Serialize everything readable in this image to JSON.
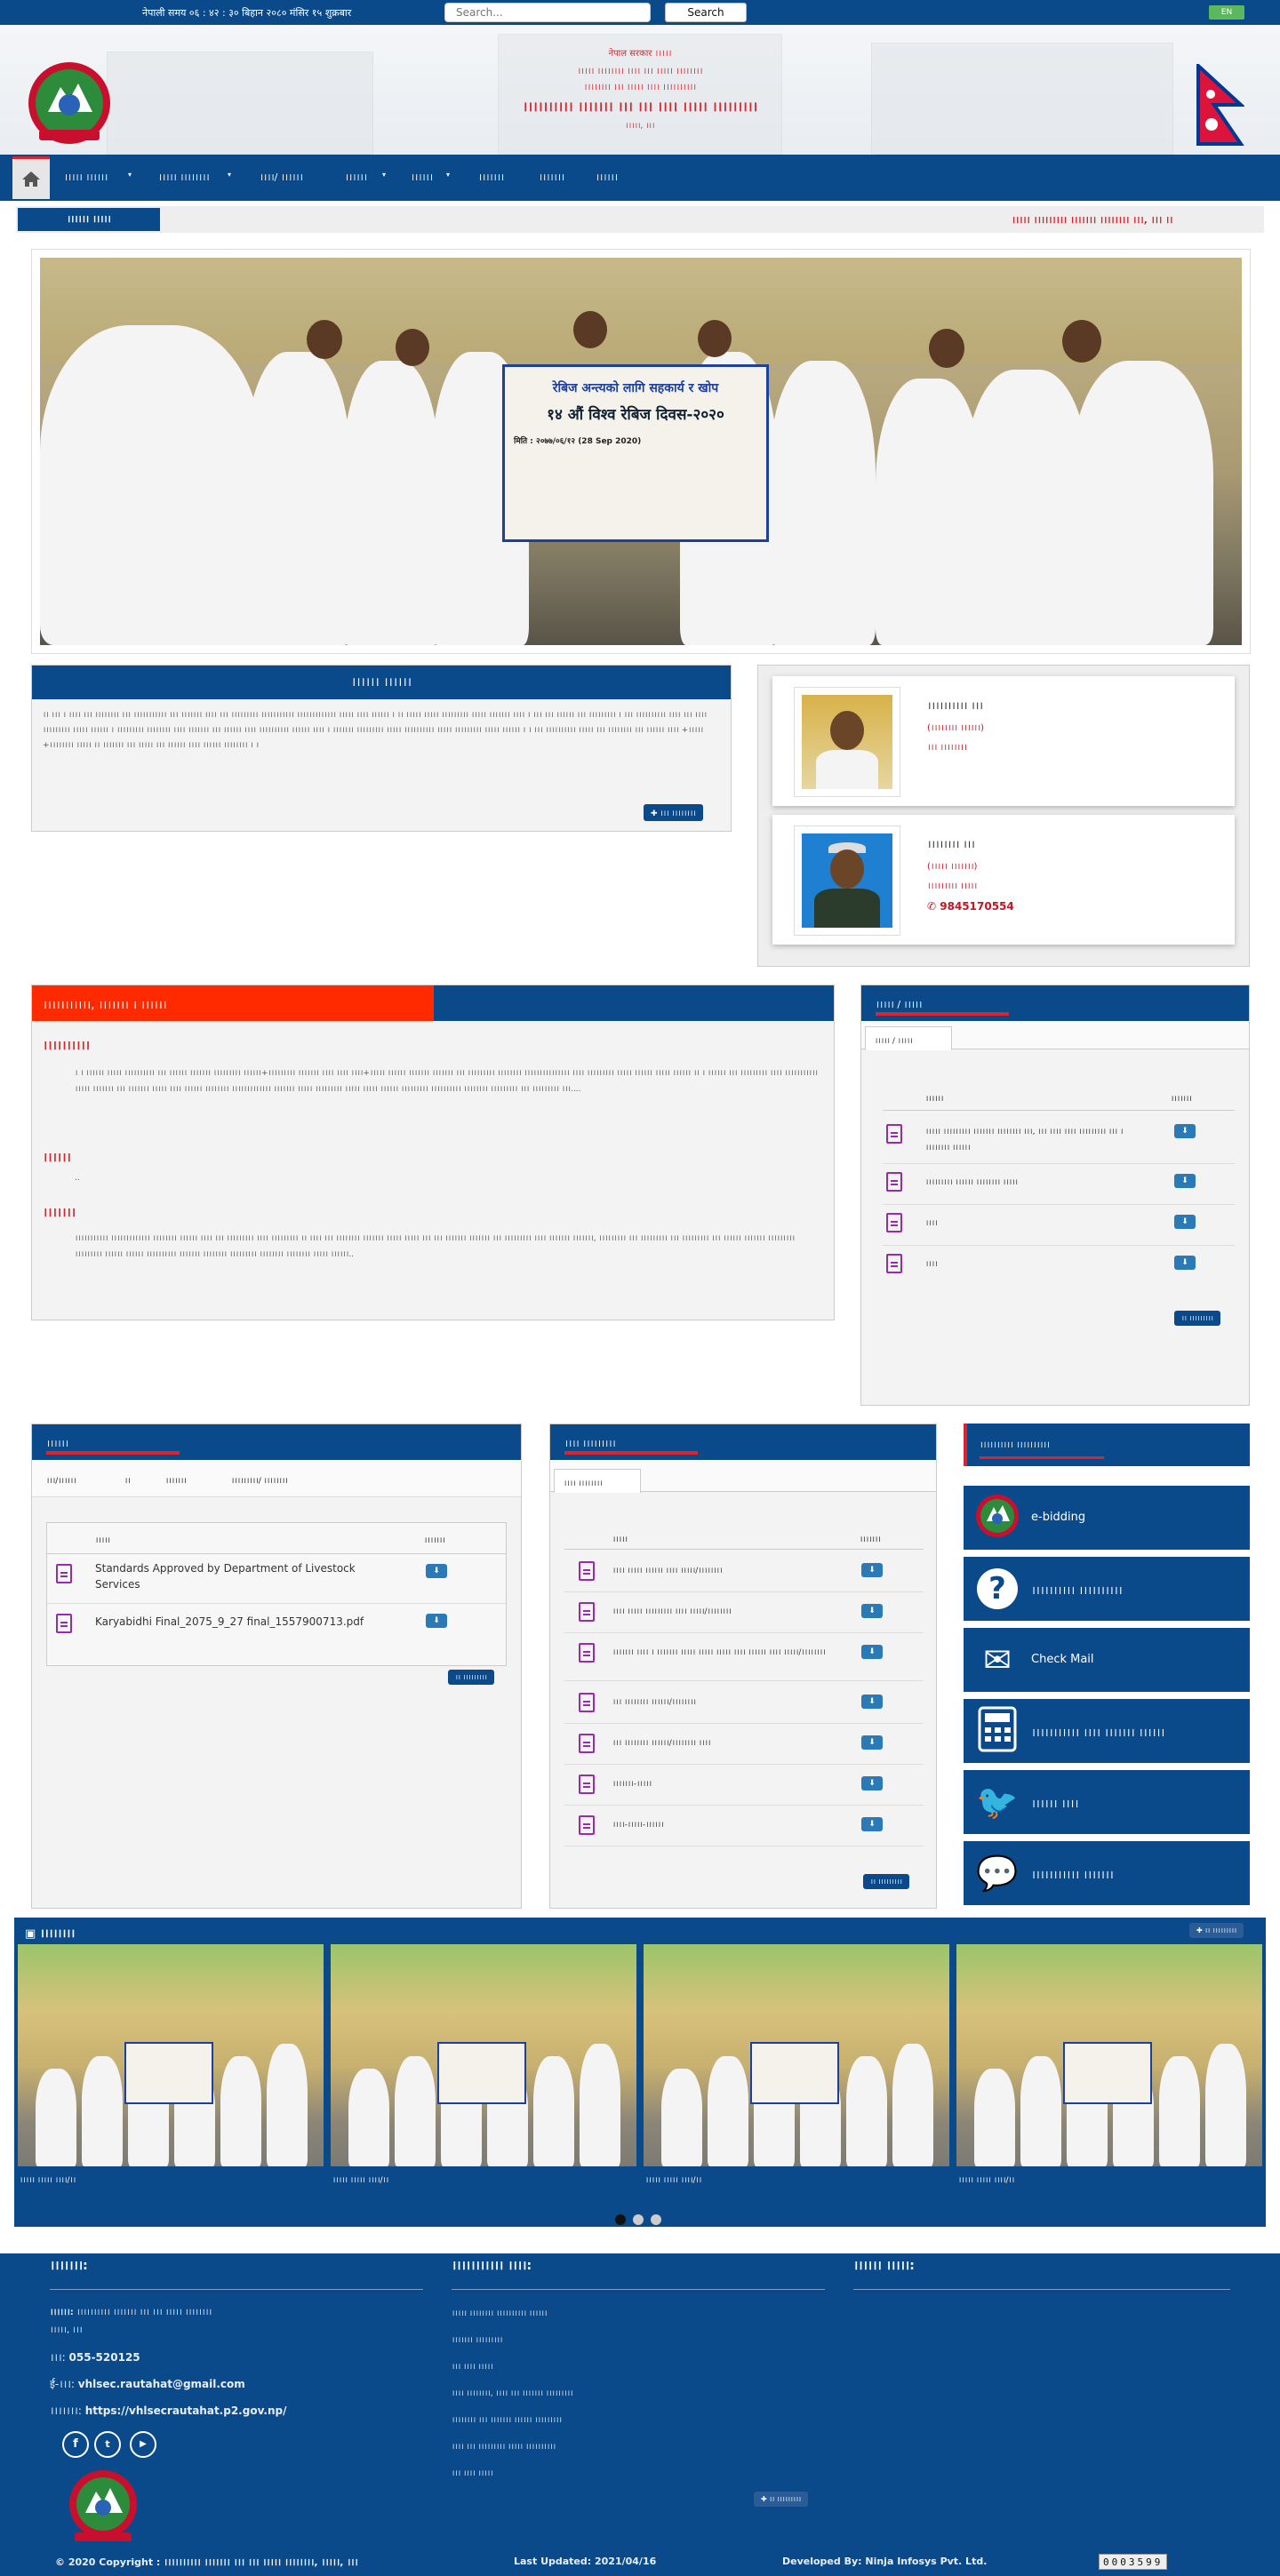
{
  "topbar": {
    "time": "नेपाली समय ०६ : ४२ : ३० बिहान   २०८० मंसिर १५ शुक्रबार",
    "search_placeholder": "Search...",
    "search_label": "Search",
    "lang_label": "EN"
  },
  "header": {
    "line1": "नेपाल सरकार ।।।।।",
    "line2": "।।।।। ।।।।।।।। ।।।। ।।। ।।।।। ।।।।।।।।",
    "line3": "।।।।।।।। ।।। ।।।।। ।।।। ।।।।।।।।।।",
    "title": "।।।।।।।।।। ।।।।।।। ।।। ।।। ।।।। ।।।।। ।।।।।।।।।",
    "location": "।।।।।, ।।।"
  },
  "nav": {
    "items": [
      "।।।।। ।।।।।।",
      "।।।।। ।।।।।।।।",
      "।।।।/ ।।।।।।",
      "।।।।।।",
      "।।।।।।",
      "।।।।।।।",
      "।।।।।।।",
      "।।।।।।"
    ]
  },
  "ticker": {
    "label": "।।।।।। ।।।।।",
    "text": "।।।।। ।।।।।।।।। ।।।।।।। ।।।।।।।। ।।।, ।।। ।।"
  },
  "slide": {
    "banner_line1": "रेबिज अन्त्यको लागि सहकार्य र खोप",
    "banner_line2": "१४ औं विश्व रेबिज दिवस-२०२०",
    "banner_line3": "मिति : २०७७/०६/१२ (28 Sep 2020)"
  },
  "about": {
    "title": "।।।।।। ।।।।।।",
    "text": "।। ।।। । ।।।। ।।। ।।।।।।।। ।।। ।।।।।।।।।।। ।।। ।।।।।।। ।।।। ।।। ।।।।।।।।। ।।।।।।।।।।। ।।।।।।।।।।।।। ।।।।। ।।।। ।।।।।। । ।। ।।।।। ।।।।। ।।।।।।।।। ।।।।। ।।।।।।। ।।।। । ।।। ।।। ।।।।।। ।।। ।।।।।।।।। । ।।। ।।।।।।।।।। ।।।। ।।। ।।।। ।।।।।।।।। ।।।।। ।।।।।। । ।।।।।।।।। ।।।।।।।। ।।।। ।।।।।।। ।।। ।।।।।। ।।।। ।।।।।।।।।। ।।।।।। ।।।। । ।।।।।।। ।।।।।।।।। ।।।।। ।।।।।।।।।। ।।।।। ।।।।।।।।। ।।।।। ।।।।।। । । ।।। ।।।।।।।।।। ।।।।। ।।। ।।।।।।।। ।।। ।।।।।। ।।।। +।।।।। +।।।।।।।। ।।।।। ।। ।।।।।।। ।।। ।।।।। ।।। ।।।।।। ।।।। ।।।।।। ।।।।।।।। । ।",
    "more_label": "।।। ।।।।।।।।"
  },
  "officials": [
    {
      "name": "।।।।।।।।।। ।।।",
      "role": "(।।।।।।।। ।।।।।।)",
      "dept": "।।। ।।।।।।।।",
      "phone": ""
    },
    {
      "name": "।।।।।।।। ।।।",
      "role": "(।।।।। ।।।।।।।)",
      "dept": "।।।।।।।।। ।।।।।",
      "phone": "9845170554"
    }
  ],
  "mission": {
    "tabs": [
      "।।।।।।।।।।।, ।।।।।।। । ।।।।।।",
      ""
    ],
    "h1": "।।।।।।।।।।",
    "p1": "। ।      ।।।।।। ।।।।। ।।।।।।।।।। ।।। ।।।।।। ।।।।।।। ।।।।।।।।। ।।।।।।+।।।।।।।।। ।।।।।।। ।।।। ।।।। ।।।।+।।।।। ।।।।।। ।।।।।।। ।।।।।।। ।।। ।।।।।।।।। ।।।।।।।। ।।।।।।।।।।।।।।। ।।।। ।।।।।।।।। ।।।।। ।।।।।। ।।।।। ।।।।।। ।। ।      ।।।।।। ।।। ।।।।।।।।। ।।।। ।।।।।।।।।।। ।।।।। ।।।।।।। ।।। ।।।।।।। ।।।।। ।।।। ।।।।।। ।।।।।।।। ।।।।।।।।।।।।। ।।।।।।। ।।।।। ।।।।।।।।। ।।।।। ।।।।। ।।।।।। ।।।।।।।।। ।।।।।।।।।। ।।।।।।।। ।।।।।।।।। ।।। ।।।।।।।।। ।।।....",
    "h2": "।।।।।।",
    "p2": "..",
    "h3": "।।।।।।।",
    "p3": "।।।।।।।।।।। ।।।।।।।।।।।।। ।।।।।।।। ।।।।।। ।।।। ।।। ।।।।।।।।। ।।।। ।।।।।।।।। ।। ।।।। ।।। ।।।।।।।। ।।।।।।। ।।।।। ।।।।। ।।। ।।। ।।।।।।। ।।।।।।। ।।। ।।।।।।।।। ।।।। ।।।।।।। ।।।।।।।, ।।।।।।।।। ।।। ।।।।।।।।। ।।। ।।।।।।।।।  ।।। ।।।।।। ।।।।।।। ।।।।।।।।। ।।।।।।।।। ।।।।।। ।।।।।। ।।।।।।।।।। ।।।।।।। ।।।।।।।। ।।।।।।।।। ।।।।।।।। ।।।।।।।। ।।।।। ।।।।।।.."
  },
  "circular": {
    "title": "।।।।। / ।।।।।",
    "tab": "।।।।। / ।।।।।",
    "col_name": "।।।।।।",
    "col_dl": "।।।।।।।",
    "rows": [
      "।।।।। ।।।।।।।।। ।।।।।।। ।।।।।।।। ।।।, ।।। ।।।। ।।।। ।।।।।।।।। ।।। । ।।।।।।।। ।।।।।।",
      "।।।।।।।।। ।।।।।। ।।।।।।।। ।।।।।",
      "।।।।",
      "।।।।"
    ],
    "more_label": "।। ।।।।।।।।।"
  },
  "laws": {
    "title": "।।।।।।",
    "tabs": [
      "।।।/।।।।।।",
      "।।",
      "।।।।।।।",
      "।।।।।।।।।/ ।।।।।।।।"
    ],
    "col_name": "।।।।।",
    "col_dl": "।।।।।।।",
    "rows": [
      "Standards Approved by Department of Livestock Services",
      "Karyabidhi Final_2075_9_27 final_1557900713.pdf"
    ],
    "more_label": "।। ।।।।।।।।।"
  },
  "publications": {
    "title": "।।।। ।।।।।।।।।",
    "tab": "।।।। ।।।।।।।।",
    "col_name": "।।।।।",
    "col_dl": "।।।।।।।",
    "rows": [
      "।।।। ।।।।। ।।।।।। ।।।। ।।।।।/।।।।।।।।",
      "।।।। ।।।।। ।।।।।।।।। ।।।। ।।।।।/।।।।।।।।",
      "।।।।।।। ।।।। । ।।।।।।। ।।।।। ।।।।। ।।।।। ।।।। ।।।।।। ।।।। ।।।।।/।।।।।।।।",
      "।।। ।।।।।।।। ।।।।।।/।।।।।।।।",
      "।।। ।।।।।।।। ।।।।।।/।।।।।।।। ।।।।",
      "।।।।।।।-।।।।।",
      "।।।।-।।।।।-।।।।।।"
    ],
    "more_label": "।। ।।।।।।।।।"
  },
  "links": {
    "title": "।।।।।।।।।। ।।।।।।।।।।",
    "items": [
      {
        "label": "e-bidding",
        "icon": "nepal-emblem-icon"
      },
      {
        "label": "।।।।।।।।।। ।।।।।।।।।।",
        "icon": "question-icon"
      },
      {
        "label": "Check Mail",
        "icon": "mail-icon"
      },
      {
        "label": "।।।।।।।।।।। ।।।। ।।।।।।। ।।।।।।",
        "icon": "calculator-icon"
      },
      {
        "label": "।।।।।। ।।।।",
        "icon": "twitter-icon"
      },
      {
        "label": "।।।।।।।।।।। ।।।।।।।",
        "icon": "chat-icon"
      }
    ]
  },
  "gallery": {
    "title": "।।।।।।।।",
    "more_label": "।। ।।।।।।।।।",
    "captions": [
      "।।।।। ।।।।। ।।।।/।।",
      "।।।।। ।।।।। ।।।।/।।",
      "।।।।। ।।।।। ।।।।/।।",
      "।।।।। ।।।।। ।।।।/।।"
    ]
  },
  "footer": {
    "contact_title": "।।।।।।।:",
    "office_prefix": "।।।।।।:",
    "office_value": "।।।।।।।।।। ।।।।।।। ।।। ।।। ।।।।। ।।।।।।।।",
    "office_loc": "।।।।।, ।।।",
    "phone_prefix": "।।।:",
    "phone_value": "055-520125",
    "email_prefix": "ई-।।।:",
    "email_value": "vhlsec.rautahat@gmail.com",
    "web_prefix": "।।।।।।।:",
    "web_value": "https://vhlsecrautahat.p2.gov.np/",
    "links_title": "।।।।।।।।।।। ।।।।:",
    "links": [
      "।।।।। ।।।।।।।। ।।।।।।।।।। ।।।।।।",
      "।।।।।।। ।।।।।।।।।",
      "।।। ।।।। ।।।।।",
      "।।।। ।।।।।।।।, ।।।। ।।। ।।।।।।। ।।।।।।।।।",
      "।।।।।।।। ।।। ।।।।।।। ।।।।।। ।।।।।।।।।",
      "।।।। ।।। ।।।।।।।।। ।।।।। ।।।।।।।।।।",
      "।।। ।।।। ।।।।।"
    ],
    "links_more": "।। ।।।।।।।।।",
    "other_title": "।।।।।। ।।।।।:",
    "copyright": "© 2020 Copyright : ।।।।।।।।।। ।।।।।।। ।।। ।।। ।।।।। ।।।।।।।।, ।।।।।, ।।।",
    "updated": "Last Updated: 2021/04/16",
    "developer": "Developed By: Ninja Infosys Pvt. Ltd.",
    "counter": "0003599"
  },
  "colors": {
    "brand_blue": "#0b4a8a",
    "accent_red": "#d9252b",
    "tab_red": "#ff2a00"
  }
}
